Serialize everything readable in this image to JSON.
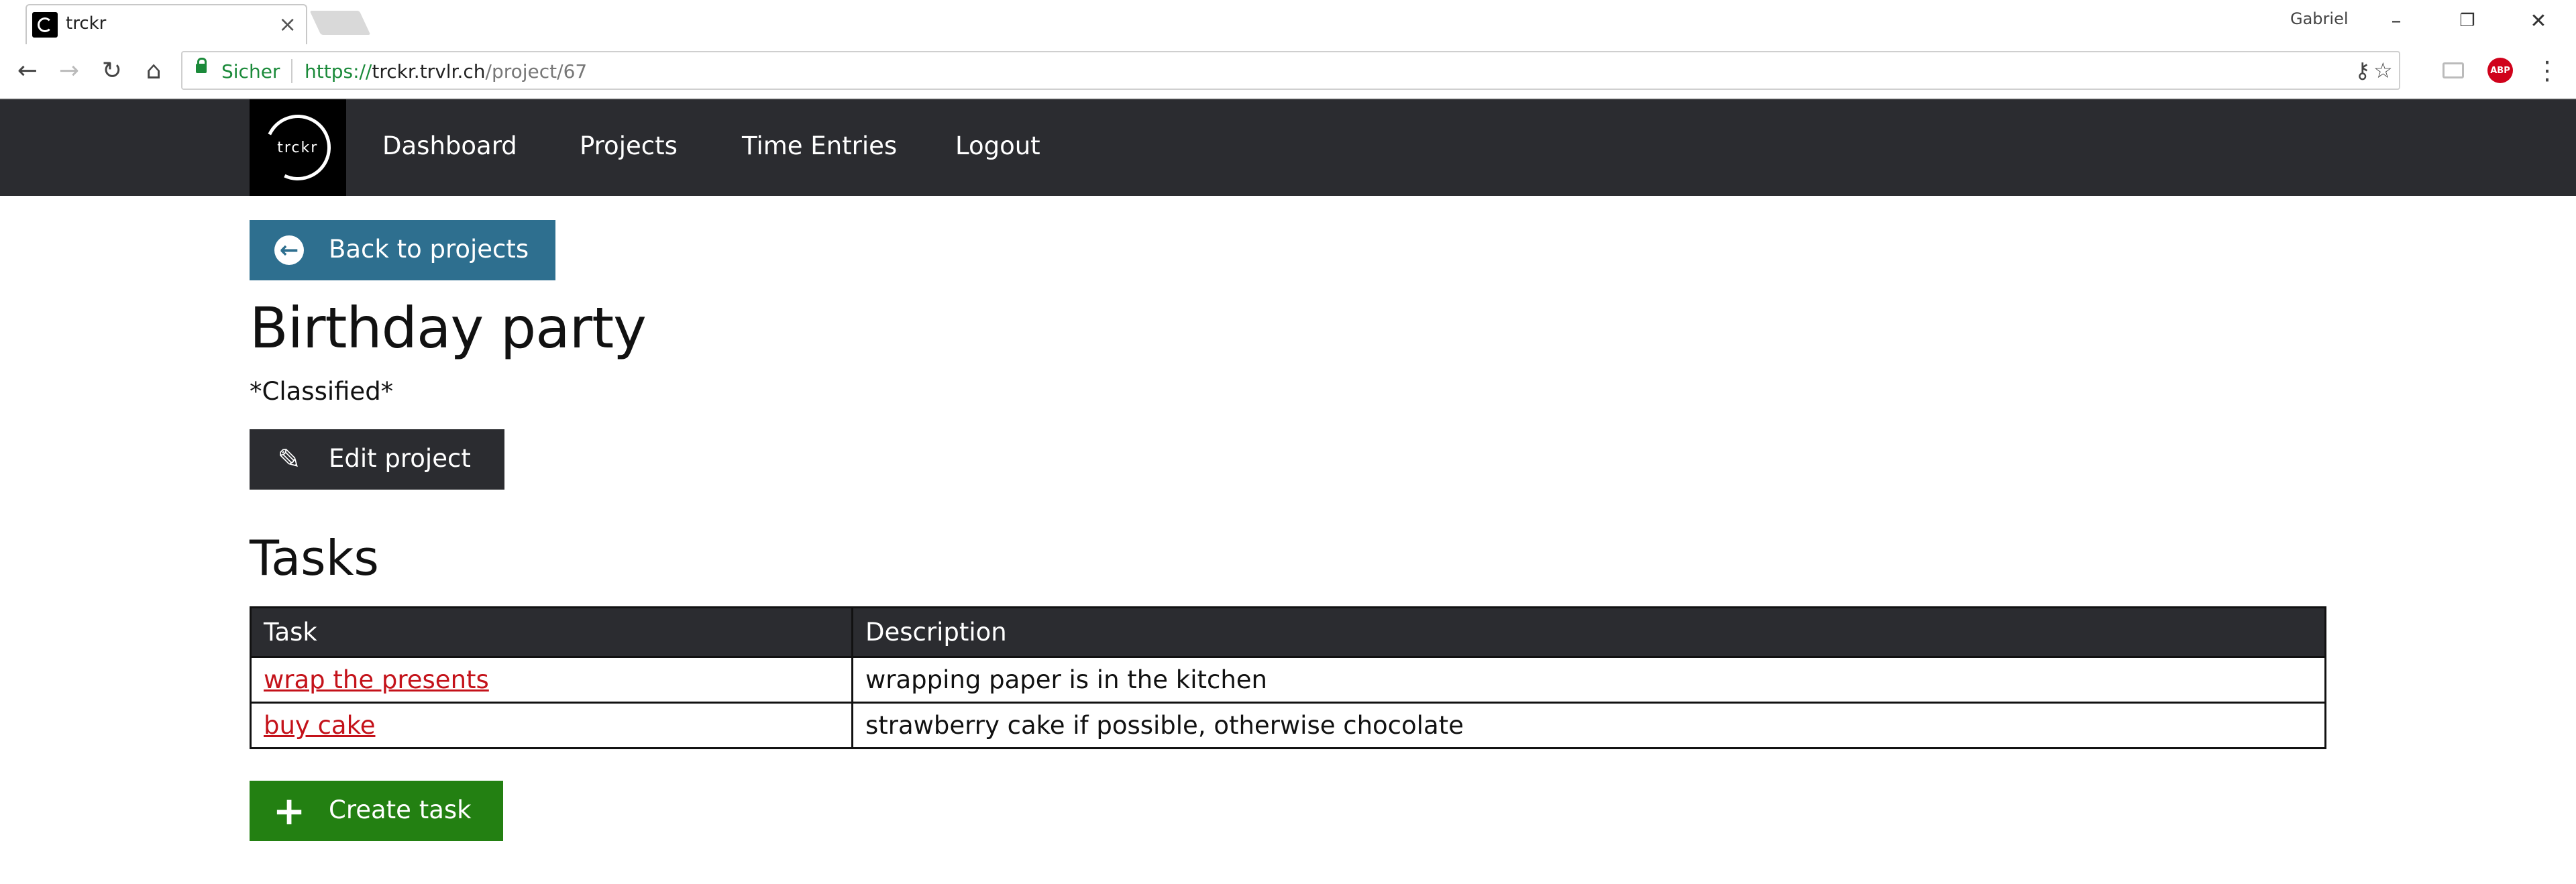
{
  "browser": {
    "tab_title": "trckr",
    "tab_close": "×",
    "profile_name": "Gabriel",
    "secure_label": "Sicher",
    "url_scheme": "https://",
    "url_host": "trckr.trvlr.ch",
    "url_path": "/project/67",
    "ext_abp_label": "ABP",
    "win_minimize": "–",
    "win_restore": "❐",
    "win_close": "✕",
    "back_glyph": "←",
    "forward_glyph": "→",
    "reload_glyph": "↻",
    "home_glyph": "⌂",
    "key_glyph": "⚷",
    "star_glyph": "☆",
    "menu_glyph": "⋮"
  },
  "app": {
    "brand_text": "trckr",
    "nav": {
      "dashboard": "Dashboard",
      "projects": "Projects",
      "time_entries": "Time Entries",
      "logout": "Logout"
    }
  },
  "project": {
    "back_label": "Back to projects",
    "title": "Birthday party",
    "description": "*Classified*",
    "edit_label": "Edit project"
  },
  "tasks": {
    "heading": "Tasks",
    "columns": {
      "task": "Task",
      "description": "Description"
    },
    "rows": [
      {
        "task": "wrap the presents",
        "description": "wrapping paper is in the kitchen"
      },
      {
        "task": "buy cake",
        "description": "strawberry cake if possible, otherwise chocolate"
      }
    ],
    "create_label": "Create task"
  },
  "colors": {
    "navbar": "#2b2c30",
    "back_button": "#2e6f8f",
    "create_button": "#238012",
    "link": "#c4121a",
    "secure": "#1b8a3a"
  }
}
